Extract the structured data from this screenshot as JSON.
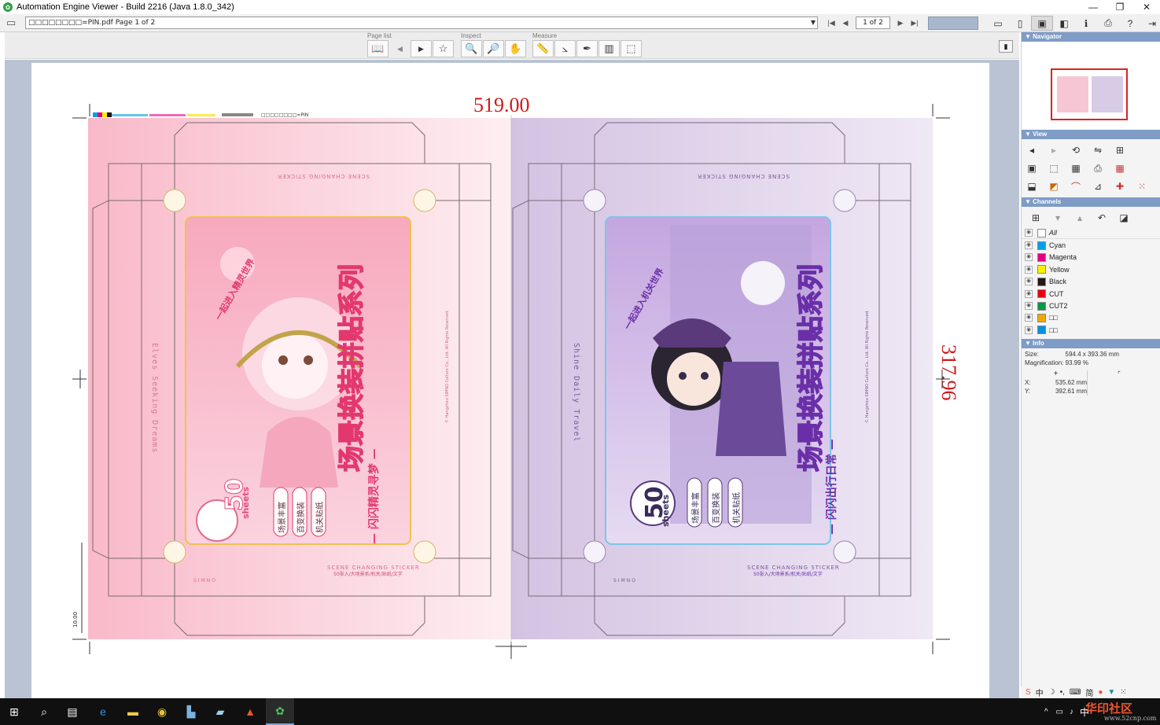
{
  "window": {
    "title": "Automation Engine Viewer - Build 2216 (Java 1.8.0_342)",
    "controls": {
      "minimize": "—",
      "restore": "❐",
      "close": "✕"
    }
  },
  "navbar": {
    "file_path": "□□□□□□□□=PIN.pdf Page 1 of 2",
    "page_field": "1 of 2"
  },
  "toolbar": {
    "groups": [
      {
        "label": "Page list"
      },
      {
        "label": "Inspect"
      },
      {
        "label": "Measure"
      }
    ]
  },
  "canvas": {
    "dimension_width": "519.00",
    "dimension_height": "317.96",
    "dimension_small": "10.00",
    "color_bar_label": "□□□□□□□□=PIN",
    "left_panel": {
      "product_title": "场景换装拼贴系列",
      "subtitle": "— 闪闪精灵寻梦 —",
      "badge_top": "一起进入精灵世界",
      "side_text": "Elves Seeking Dreams",
      "count": "50",
      "count_unit": "sheets",
      "features": [
        "场景丰富",
        "百变换装",
        "机关贴纸"
      ],
      "footer_en": "SCENE CHANGING STICKER",
      "footer_cn": "50张入/大场景系/机关/贴纸/文字",
      "brand": "SIMNO",
      "copyright": "© Hangzhou SIMNO Culture Co., Ltd. All Rights Reserved."
    },
    "right_panel": {
      "product_title": "场景换装拼贴系列",
      "subtitle": "— 闪闪出行日常 —",
      "badge_top": "一起进入机关世界",
      "side_text": "Shine Daily Travel",
      "count": "50",
      "count_unit": "sheets",
      "features": [
        "场景丰富",
        "百变换装",
        "机关贴纸"
      ],
      "footer_en": "SCENE CHANGING STICKER",
      "footer_cn": "50张入/大场景系/机关/贴纸/文字",
      "brand": "SIMNO",
      "copyright": "© Hangzhou SIMNO Culture Co., Ltd. All Rights Reserved."
    }
  },
  "panel": {
    "navigator_label": "Navigator",
    "view_label": "View",
    "channels_label": "Channels",
    "info_label": "Info",
    "channels": [
      {
        "name": "All",
        "color": "#ffffff"
      },
      {
        "name": "Cyan",
        "color": "#00a0e9"
      },
      {
        "name": "Magenta",
        "color": "#e4007f"
      },
      {
        "name": "Yellow",
        "color": "#fff100"
      },
      {
        "name": "Black",
        "color": "#231815"
      },
      {
        "name": "CUT",
        "color": "#e60012"
      },
      {
        "name": "CUT2",
        "color": "#009944"
      },
      {
        "name": "□□",
        "color": "#f0a800"
      },
      {
        "name": "□□",
        "color": "#0090e0"
      }
    ],
    "info": {
      "size_label": "Size:",
      "size_value": "594.4 x 393.36 mm",
      "magnification": "Magnification: 93.99 %",
      "x_label": "X:",
      "x_value": "535.62 mm",
      "y_label": "Y:",
      "y_value": "392.61 mm"
    }
  },
  "taskbar": {
    "lang": "中",
    "ime": [
      "中",
      "简"
    ]
  },
  "watermark": {
    "text": "华印社区",
    "url": "www.52cnp.com"
  }
}
